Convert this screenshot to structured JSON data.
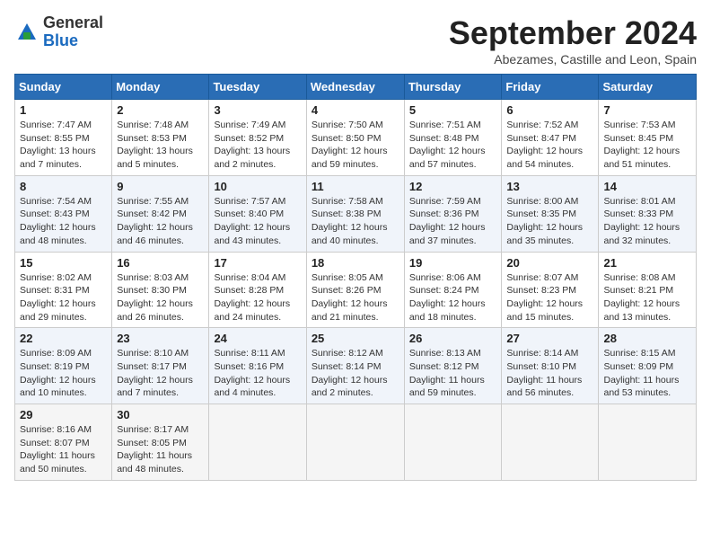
{
  "logo": {
    "general": "General",
    "blue": "Blue"
  },
  "header": {
    "month": "September 2024",
    "location": "Abezames, Castille and Leon, Spain"
  },
  "weekdays": [
    "Sunday",
    "Monday",
    "Tuesday",
    "Wednesday",
    "Thursday",
    "Friday",
    "Saturday"
  ],
  "weeks": [
    [
      {
        "day": "1",
        "info": "Sunrise: 7:47 AM\nSunset: 8:55 PM\nDaylight: 13 hours\nand 7 minutes."
      },
      {
        "day": "2",
        "info": "Sunrise: 7:48 AM\nSunset: 8:53 PM\nDaylight: 13 hours\nand 5 minutes."
      },
      {
        "day": "3",
        "info": "Sunrise: 7:49 AM\nSunset: 8:52 PM\nDaylight: 13 hours\nand 2 minutes."
      },
      {
        "day": "4",
        "info": "Sunrise: 7:50 AM\nSunset: 8:50 PM\nDaylight: 12 hours\nand 59 minutes."
      },
      {
        "day": "5",
        "info": "Sunrise: 7:51 AM\nSunset: 8:48 PM\nDaylight: 12 hours\nand 57 minutes."
      },
      {
        "day": "6",
        "info": "Sunrise: 7:52 AM\nSunset: 8:47 PM\nDaylight: 12 hours\nand 54 minutes."
      },
      {
        "day": "7",
        "info": "Sunrise: 7:53 AM\nSunset: 8:45 PM\nDaylight: 12 hours\nand 51 minutes."
      }
    ],
    [
      {
        "day": "8",
        "info": "Sunrise: 7:54 AM\nSunset: 8:43 PM\nDaylight: 12 hours\nand 48 minutes."
      },
      {
        "day": "9",
        "info": "Sunrise: 7:55 AM\nSunset: 8:42 PM\nDaylight: 12 hours\nand 46 minutes."
      },
      {
        "day": "10",
        "info": "Sunrise: 7:57 AM\nSunset: 8:40 PM\nDaylight: 12 hours\nand 43 minutes."
      },
      {
        "day": "11",
        "info": "Sunrise: 7:58 AM\nSunset: 8:38 PM\nDaylight: 12 hours\nand 40 minutes."
      },
      {
        "day": "12",
        "info": "Sunrise: 7:59 AM\nSunset: 8:36 PM\nDaylight: 12 hours\nand 37 minutes."
      },
      {
        "day": "13",
        "info": "Sunrise: 8:00 AM\nSunset: 8:35 PM\nDaylight: 12 hours\nand 35 minutes."
      },
      {
        "day": "14",
        "info": "Sunrise: 8:01 AM\nSunset: 8:33 PM\nDaylight: 12 hours\nand 32 minutes."
      }
    ],
    [
      {
        "day": "15",
        "info": "Sunrise: 8:02 AM\nSunset: 8:31 PM\nDaylight: 12 hours\nand 29 minutes."
      },
      {
        "day": "16",
        "info": "Sunrise: 8:03 AM\nSunset: 8:30 PM\nDaylight: 12 hours\nand 26 minutes."
      },
      {
        "day": "17",
        "info": "Sunrise: 8:04 AM\nSunset: 8:28 PM\nDaylight: 12 hours\nand 24 minutes."
      },
      {
        "day": "18",
        "info": "Sunrise: 8:05 AM\nSunset: 8:26 PM\nDaylight: 12 hours\nand 21 minutes."
      },
      {
        "day": "19",
        "info": "Sunrise: 8:06 AM\nSunset: 8:24 PM\nDaylight: 12 hours\nand 18 minutes."
      },
      {
        "day": "20",
        "info": "Sunrise: 8:07 AM\nSunset: 8:23 PM\nDaylight: 12 hours\nand 15 minutes."
      },
      {
        "day": "21",
        "info": "Sunrise: 8:08 AM\nSunset: 8:21 PM\nDaylight: 12 hours\nand 13 minutes."
      }
    ],
    [
      {
        "day": "22",
        "info": "Sunrise: 8:09 AM\nSunset: 8:19 PM\nDaylight: 12 hours\nand 10 minutes."
      },
      {
        "day": "23",
        "info": "Sunrise: 8:10 AM\nSunset: 8:17 PM\nDaylight: 12 hours\nand 7 minutes."
      },
      {
        "day": "24",
        "info": "Sunrise: 8:11 AM\nSunset: 8:16 PM\nDaylight: 12 hours\nand 4 minutes."
      },
      {
        "day": "25",
        "info": "Sunrise: 8:12 AM\nSunset: 8:14 PM\nDaylight: 12 hours\nand 2 minutes."
      },
      {
        "day": "26",
        "info": "Sunrise: 8:13 AM\nSunset: 8:12 PM\nDaylight: 11 hours\nand 59 minutes."
      },
      {
        "day": "27",
        "info": "Sunrise: 8:14 AM\nSunset: 8:10 PM\nDaylight: 11 hours\nand 56 minutes."
      },
      {
        "day": "28",
        "info": "Sunrise: 8:15 AM\nSunset: 8:09 PM\nDaylight: 11 hours\nand 53 minutes."
      }
    ],
    [
      {
        "day": "29",
        "info": "Sunrise: 8:16 AM\nSunset: 8:07 PM\nDaylight: 11 hours\nand 50 minutes."
      },
      {
        "day": "30",
        "info": "Sunrise: 8:17 AM\nSunset: 8:05 PM\nDaylight: 11 hours\nand 48 minutes."
      },
      {
        "day": "",
        "info": ""
      },
      {
        "day": "",
        "info": ""
      },
      {
        "day": "",
        "info": ""
      },
      {
        "day": "",
        "info": ""
      },
      {
        "day": "",
        "info": ""
      }
    ]
  ]
}
